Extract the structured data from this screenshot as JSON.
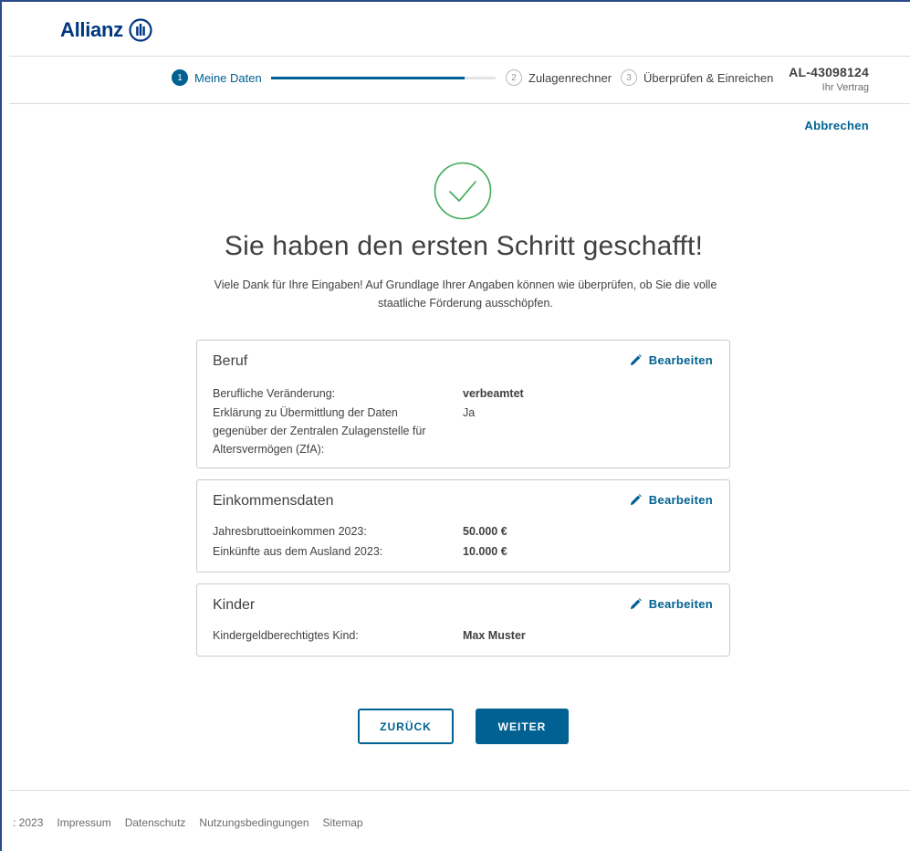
{
  "brand": {
    "name": "Allianz"
  },
  "stepper": {
    "steps": [
      {
        "number": "1",
        "label": "Meine Daten",
        "state": "active"
      },
      {
        "number": "2",
        "label": "Zulagenrechner",
        "state": "inactive"
      },
      {
        "number": "3",
        "label": "Überprüfen & Einreichen",
        "state": "inactive"
      }
    ],
    "step1_progress_percent": 86
  },
  "contract": {
    "number": "AL-43098124",
    "label": "Ihr Vertrag"
  },
  "cancel_label": "Abbrechen",
  "success": {
    "icon": "checkmark-circle-icon",
    "headline": "Sie haben den ersten Schritt geschafft!",
    "text": "Viele Dank für Ihre Eingaben! Auf Grundlage Ihrer Angaben können wie überprüfen, ob Sie die volle staatliche Förderung ausschöpfen."
  },
  "cards": [
    {
      "title": "Beruf",
      "edit_label": "Bearbeiten",
      "rows": [
        {
          "label": "Berufliche Veränderung:",
          "value": "verbeamtet"
        },
        {
          "label": "Erklärung zu Übermittlung der Daten gegenüber der Zentralen Zulagenstelle für Altersvermögen (ZfA):",
          "value": "Ja"
        }
      ]
    },
    {
      "title": "Einkommensdaten",
      "edit_label": "Bearbeiten",
      "rows": [
        {
          "label": "Jahresbruttoeinkommen 2023:",
          "value": "50.000 €"
        },
        {
          "label": "Einkünfte aus dem Ausland 2023:",
          "value": "10.000 €"
        }
      ]
    },
    {
      "title": "Kinder",
      "edit_label": "Bearbeiten",
      "rows": [
        {
          "label": "Kindergeldberechtigtes Kind:",
          "value": "Max Muster"
        }
      ]
    }
  ],
  "buttons": {
    "back": "ZURÜCK",
    "next": "WEITER"
  },
  "footer": {
    "copyright": ": 2023",
    "links": [
      "Impressum",
      "Datenschutz",
      "Nutzungsbedingungen",
      "Sitemap"
    ]
  },
  "colors": {
    "brand": "#003781",
    "primary": "#006192",
    "success": "#3daa55",
    "border": "#c9c9c9",
    "text": "#414141"
  }
}
